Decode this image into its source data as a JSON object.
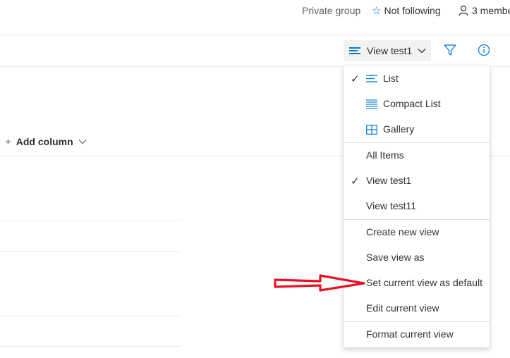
{
  "header": {
    "group_type": "Private group",
    "follow_label": "Not following",
    "members_label": "3 membe"
  },
  "command_bar": {
    "view_button_label": "View test1"
  },
  "list": {
    "add_column_label": "Add column"
  },
  "view_menu": {
    "layouts": [
      {
        "label": "List",
        "icon": "list-lines-icon",
        "checked": true
      },
      {
        "label": "Compact List",
        "icon": "compact-list-icon",
        "checked": false
      },
      {
        "label": "Gallery",
        "icon": "gallery-grid-icon",
        "checked": false
      }
    ],
    "views": [
      {
        "label": "All Items",
        "checked": false
      },
      {
        "label": "View test1",
        "checked": true
      },
      {
        "label": "View test11",
        "checked": false
      }
    ],
    "actions": [
      {
        "label": "Create new view"
      },
      {
        "label": "Save view as"
      },
      {
        "label": "Set current view as default"
      },
      {
        "label": "Edit current view"
      }
    ],
    "format": {
      "label": "Format current view"
    }
  },
  "annotation": {
    "arrow_color": "#e81123"
  },
  "colors": {
    "accent": "#0078d4"
  }
}
